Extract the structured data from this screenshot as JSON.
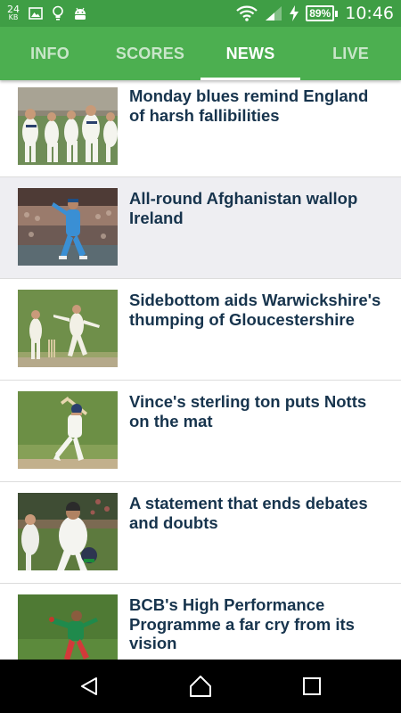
{
  "status_bar": {
    "data_rate": "24",
    "data_unit": "KB",
    "battery": "89%",
    "time": "10:46"
  },
  "tabs": [
    {
      "label": "INFO",
      "active": false
    },
    {
      "label": "SCORES",
      "active": false
    },
    {
      "label": "NEWS",
      "active": true
    },
    {
      "label": "LIVE",
      "active": false
    }
  ],
  "news": [
    {
      "headline": "Monday blues remind England of harsh fallibilities",
      "thumb": "england-fielders-photo"
    },
    {
      "headline": "All-round Afghanistan wallop Ireland",
      "thumb": "afghanistan-bowler-photo"
    },
    {
      "headline": "Sidebottom aids Warwickshire's thumping of Gloucestershire",
      "thumb": "county-bowler-photo"
    },
    {
      "headline": "Vince's sterling ton puts Notts on the mat",
      "thumb": "batsman-drive-photo"
    },
    {
      "headline": "A statement that ends debates and doubts",
      "thumb": "india-captain-photo"
    },
    {
      "headline": "BCB's High Performance Programme a far cry from its vision",
      "thumb": "bangladesh-fielder-photo"
    }
  ],
  "colors": {
    "status_bar": "#3f9e45",
    "tab_bar": "#4caf50",
    "headline": "#17344d",
    "inactive_tab": "#c8e6c9"
  }
}
